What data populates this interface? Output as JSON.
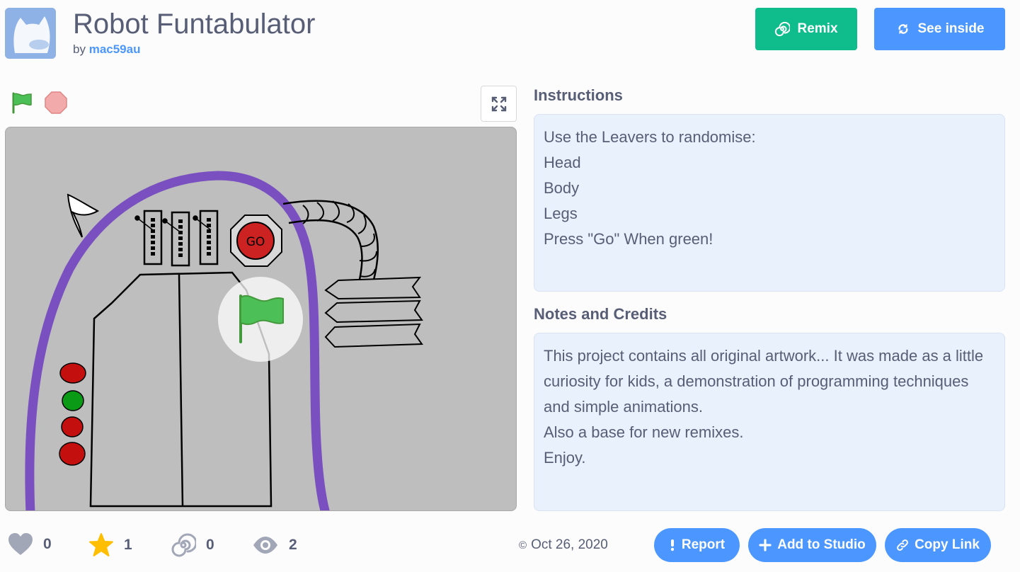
{
  "project": {
    "title": "Robot Funtabulator",
    "by_prefix": "by",
    "author": "mac59au"
  },
  "actions": {
    "remix_label": "Remix",
    "see_inside_label": "See inside"
  },
  "player": {
    "go_text": "GO"
  },
  "instructions": {
    "heading": "Instructions",
    "text": "Use the Leavers to randomise:\nHead\nBody\nLegs\nPress \"Go\" When green!"
  },
  "notes": {
    "heading": "Notes and Credits",
    "text": "This project contains all original artwork... It was made as a little curiosity for kids, a demonstration of programming techniques and simple animations.\nAlso a base for new remixes.\nEnjoy."
  },
  "stats": {
    "loves": "0",
    "favorites": "1",
    "remixes": "0",
    "views": "2"
  },
  "shared": {
    "date_symbol": "©",
    "date": "Oct 26, 2020"
  },
  "footer_actions": {
    "report_label": "Report",
    "add_to_studio_label": "Add to Studio",
    "copy_link_label": "Copy Link"
  },
  "colors": {
    "remix": "#0fbd8c",
    "primary": "#4c97ff",
    "text": "#575e75",
    "notes_bg": "#e9f1fc",
    "stage_bg": "#bebebe",
    "robot_outline": "#7a50c0",
    "star": "#ffbf00",
    "flag_green": "#4cbf56"
  },
  "icons": {
    "remix": "remix-spiral-icon",
    "see_inside": "see-inside-arrows-icon",
    "green_flag": "green-flag-icon",
    "stop": "stop-sign-icon",
    "fullscreen": "fullscreen-icon",
    "love": "heart-icon",
    "favorite": "star-icon",
    "remix_count": "remix-spiral-icon",
    "views": "eye-icon",
    "report": "exclamation-icon",
    "add": "plus-icon",
    "link": "link-icon"
  }
}
